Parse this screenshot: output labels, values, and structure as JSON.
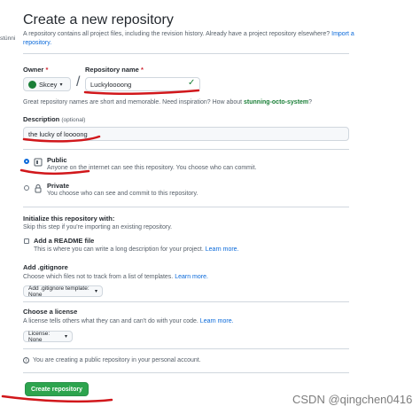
{
  "header": {
    "title": "Create a new repository",
    "intro": "A repository contains all project files, including the revision history. Already have a project repository elsewhere?",
    "import_link": "Import a repository."
  },
  "edge_text": "stünni",
  "owner": {
    "label": "Owner",
    "required": "*",
    "value": "Skcey"
  },
  "repo": {
    "label": "Repository name",
    "required": "*",
    "value": "Luckyloooong",
    "hint": "Great repository names are short and memorable. Need inspiration? How about",
    "suggestion": "stunning-octo-system",
    "hint_end": "?"
  },
  "description": {
    "label": "Description",
    "optional": "(optional)",
    "value": "the lucky of loooong"
  },
  "visibility": {
    "public_title": "Public",
    "public_desc": "Anyone on the internet can see this repository. You choose who can commit.",
    "private_title": "Private",
    "private_desc": "You choose who can see and commit to this repository."
  },
  "init": {
    "title": "Initialize this repository with:",
    "subtitle": "Skip this step if you're importing an existing repository.",
    "readme_label": "Add a README file",
    "readme_desc": "This is where you can write a long description for your project.",
    "learn_more": "Learn more."
  },
  "gitignore": {
    "title": "Add .gitignore",
    "desc": "Choose which files not to track from a list of templates.",
    "learn_more": "Learn more.",
    "select": "Add .gitignore template: None"
  },
  "license": {
    "title": "Choose a license",
    "desc": "A license tells others what they can and can't do with your code.",
    "learn_more": "Learn more.",
    "select": "License: None"
  },
  "notice": "You are creating a public repository in your personal account.",
  "create_button": "Create repository",
  "watermark": "CSDN @qingchen0416",
  "colors": {
    "accent": "#0969da",
    "success": "#2da44e",
    "annotation": "#d1171b"
  },
  "icons": [
    "person-avatar-icon",
    "caret-down-icon",
    "check-icon",
    "repo-public-icon",
    "lock-icon",
    "info-icon"
  ]
}
